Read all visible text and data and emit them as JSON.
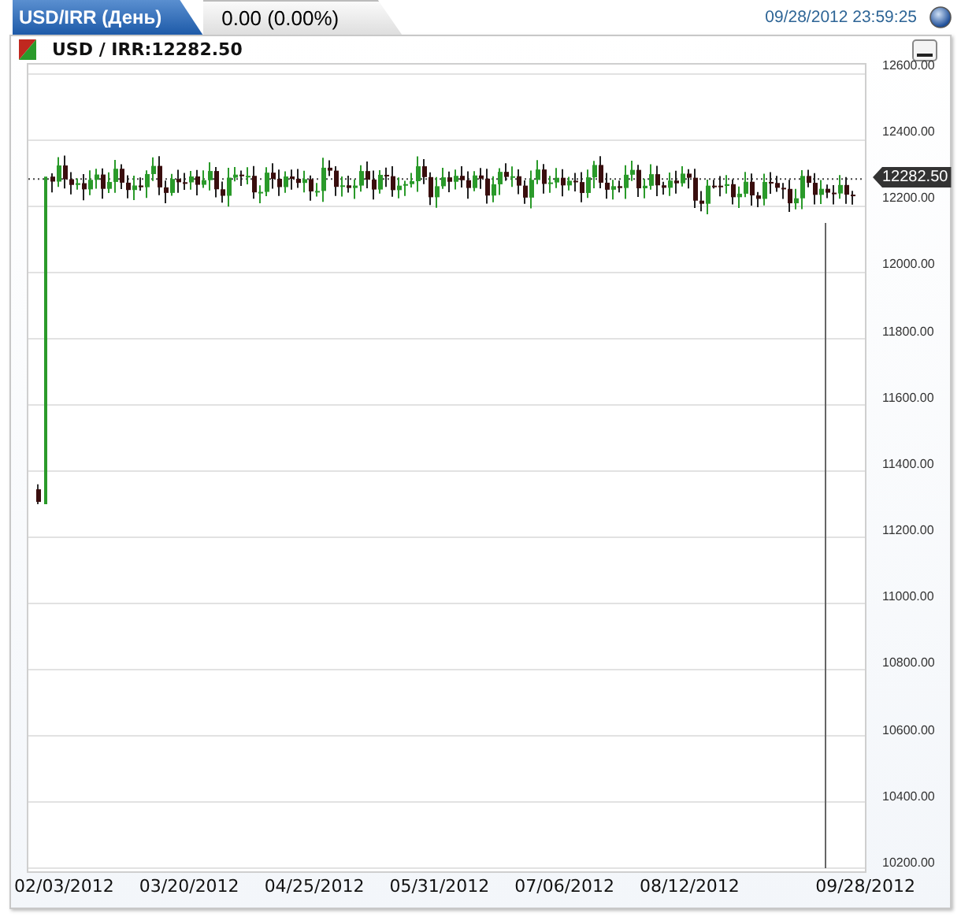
{
  "header": {
    "title": "USD/IRR (День)",
    "change": "0.00 (0.00%)",
    "datetime": "09/28/2012 23:59:25"
  },
  "instrument": {
    "label": "USD / IRR:12282.50"
  },
  "chart": {
    "y_axis": [
      "12600.00",
      "12400.00",
      "12200.00",
      "12000.00",
      "11800.00",
      "11600.00",
      "11400.00",
      "11200.00",
      "11000.00",
      "10800.00",
      "10600.00",
      "10400.00",
      "10200.00"
    ],
    "x_axis": [
      "02/03/2012",
      "03/20/2012",
      "04/25/2012",
      "05/31/2012",
      "07/06/2012",
      "08/12/2012",
      "09/28/2012"
    ],
    "price_tag": "12282.50"
  }
}
